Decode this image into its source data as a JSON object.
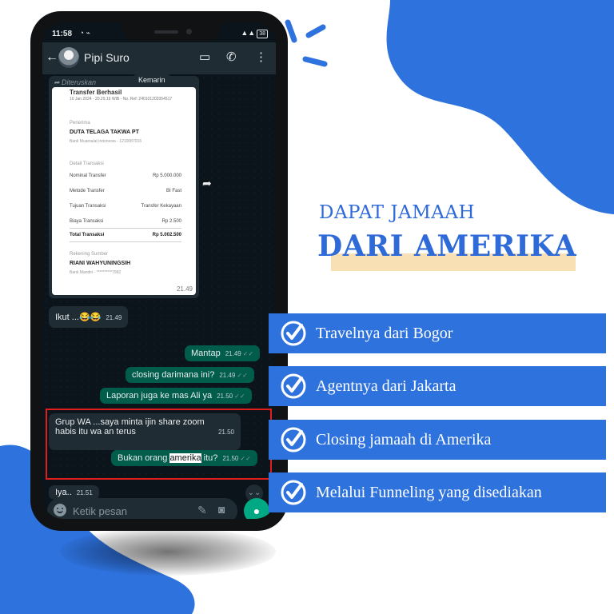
{
  "colors": {
    "brand_blue": "#2e72de",
    "heading_blue": "#2f6ad9",
    "underline_peach": "#f9dfb4",
    "wa_outgoing": "#005c4b",
    "wa_incoming": "#1f2c33",
    "highlight_red": "#e11d1d"
  },
  "statusbar": {
    "time": "11:58",
    "right_icons": "⚡ 5G ▮▮ ",
    "battery": "38"
  },
  "header": {
    "contact_name": "Pipi Suro"
  },
  "chat": {
    "date_chip": "Kemarin",
    "forwarded_label": "Diteruskan",
    "receipt": {
      "title": "Transfer Berhasil",
      "subtitle": "10 Jan 2024 - 20.29.19 WIB - No. Ref: 240101202054517",
      "recipient_label": "Penerima",
      "recipient_name": "DUTA TELAGA TAKWA PT",
      "recipient_bank": "Bank Muamalat Indonesia - 1210087016",
      "details_label": "Detail Transaksi",
      "rows": [
        {
          "label": "Nominal Transfer",
          "value": "Rp 5.000.000"
        },
        {
          "label": "Metode Transfer",
          "value": "BI Fast"
        },
        {
          "label": "Tujuan Transaksi",
          "value": "Transfer Kekayaan"
        },
        {
          "label": "Biaya Transaksi",
          "value": "Rp 2.500"
        }
      ],
      "total_label": "Total Transaksi",
      "total_value": "Rp 5.002.500",
      "source_label": "Rekening Sumber",
      "source_name": "RIANI WAHYUNINGSIH",
      "source_bank": "Bank Mandiri - **********7992",
      "time": "21.49"
    },
    "messages": [
      {
        "text": "Ikut ...😂😂",
        "time": "21.49"
      },
      {
        "text": "Mantap",
        "time": "21.49"
      },
      {
        "text": "closing darimana ini?",
        "time": "21.49"
      },
      {
        "text": "Laporan juga ke mas Ali ya",
        "time": "21.50"
      },
      {
        "text_line1": "Grup WA ...saya minta ijin share zoom",
        "text_line2": "habis itu wa an terus",
        "time": "21.50"
      },
      {
        "text_before": "Bukan orang ",
        "text_highlight": "amerika",
        "text_after": " itu?",
        "time": "21.50"
      },
      {
        "text": "Iya..",
        "time": "21.51"
      }
    ],
    "input_placeholder": "Ketik pesan"
  },
  "promo": {
    "heading_line1": "DAPAT JAMAAH",
    "heading_line2": "DARI AMERIKA",
    "features": [
      "Travelnya dari Bogor",
      "Agentnya dari Jakarta",
      "Closing jamaah di Amerika",
      "Melalui Funneling yang disediakan"
    ]
  }
}
